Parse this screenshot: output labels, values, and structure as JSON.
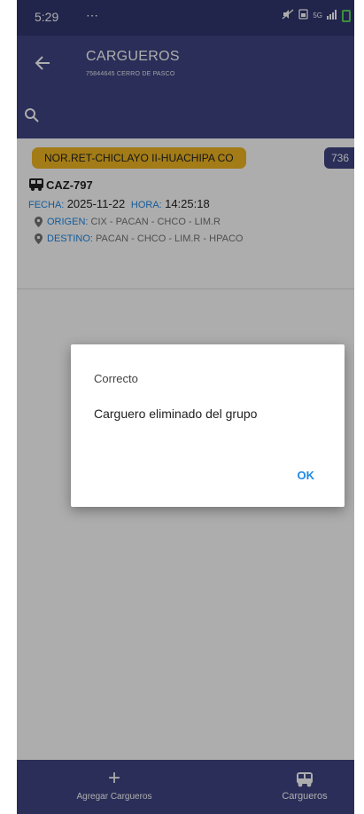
{
  "status_bar": {
    "time": "5:29",
    "notif": "⋯",
    "network": "5G"
  },
  "app_bar": {
    "title": "CARGUEROS",
    "subtitle": "75844645 CERRO DE PASCO"
  },
  "card": {
    "route": "NOR.RET-CHICLAYO II-HUACHIPA CO",
    "number": "736",
    "plate": "CAZ-797",
    "fecha_label": "FECHA:",
    "fecha_value": "2025-11-22",
    "hora_label": "HORA:",
    "hora_value": "14:25:18",
    "origen_label": "ORIGEN:",
    "origen_value": "CIX - PACAN - CHCO - LIM.R",
    "destino_label": "DESTINO:",
    "destino_value": "PACAN - CHCO - LIM.R - HPACO"
  },
  "bottom_nav": {
    "add_icon": "+",
    "add_label": "Agregar Cargueros",
    "cargueros_label": "Cargueros"
  },
  "dialog": {
    "title": "Correcto",
    "message": "Carguero eliminado del grupo",
    "ok_label": "OK"
  },
  "colors": {
    "primary": "#3f4482",
    "status_bar": "#31366f",
    "route_chip": "#f0b722",
    "accent_blue": "#1e88e5"
  },
  "icons": {
    "back": "arrow-left-icon",
    "search": "search-icon",
    "bus": "bus-icon",
    "pin": "location-pin-icon",
    "add": "plus-icon"
  }
}
